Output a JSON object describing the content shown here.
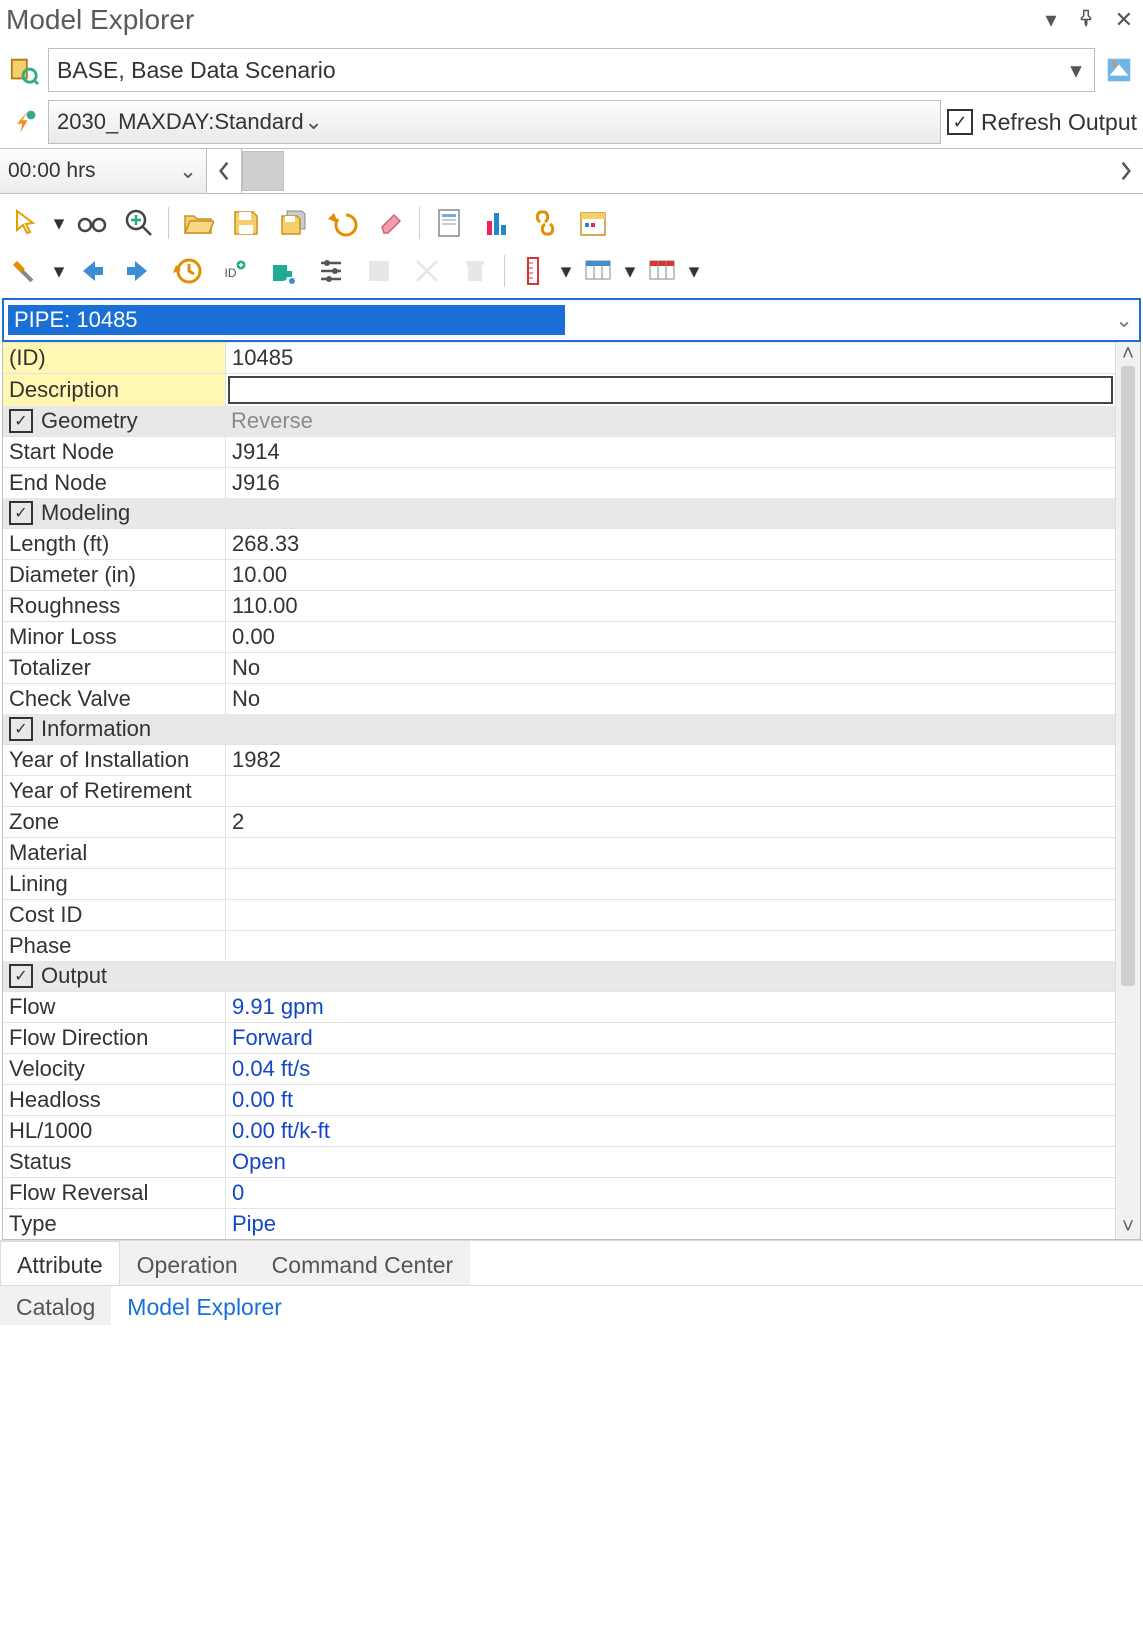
{
  "window": {
    "title": "Model Explorer"
  },
  "scenario": {
    "label": "BASE, Base Data Scenario"
  },
  "simulation": {
    "label": "2030_MAXDAY:Standard",
    "refresh_label": "Refresh Output"
  },
  "time": {
    "value": "00:00 hrs"
  },
  "element": {
    "selector": "PIPE: 10485"
  },
  "props": {
    "id_label": "(ID)",
    "id_value": "10485",
    "desc_label": "Description",
    "desc_value": "",
    "geometry_header": "Geometry",
    "reverse_label": "Reverse",
    "start_node_label": "Start Node",
    "start_node_value": "J914",
    "end_node_label": "End Node",
    "end_node_value": "J916",
    "modeling_header": "Modeling",
    "length_label": "Length (ft)",
    "length_value": "268.33",
    "diameter_label": "Diameter (in)",
    "diameter_value": "10.00",
    "roughness_label": "Roughness",
    "roughness_value": "110.00",
    "minor_loss_label": "Minor Loss",
    "minor_loss_value": "0.00",
    "totalizer_label": "Totalizer",
    "totalizer_value": "No",
    "check_valve_label": "Check Valve",
    "check_valve_value": "No",
    "information_header": "Information",
    "year_install_label": "Year of Installation",
    "year_install_value": "1982",
    "year_retire_label": "Year of Retirement",
    "year_retire_value": "",
    "zone_label": "Zone",
    "zone_value": "2",
    "material_label": "Material",
    "material_value": "",
    "lining_label": "Lining",
    "lining_value": "",
    "cost_id_label": "Cost ID",
    "cost_id_value": "",
    "phase_label": "Phase",
    "phase_value": "",
    "output_header": "Output",
    "flow_label": "Flow",
    "flow_value": "9.91 gpm",
    "flow_dir_label": "Flow Direction",
    "flow_dir_value": "Forward",
    "velocity_label": "Velocity",
    "velocity_value": "0.04 ft/s",
    "headloss_label": "Headloss",
    "headloss_value": "0.00 ft",
    "hl1000_label": "HL/1000",
    "hl1000_value": "0.00 ft/k-ft",
    "status_label": "Status",
    "status_value": "Open",
    "flow_reversal_label": "Flow Reversal",
    "flow_reversal_value": "0",
    "type_label": "Type",
    "type_value": "Pipe"
  },
  "tabs": {
    "attribute": "Attribute",
    "operation": "Operation",
    "command_center": "Command Center"
  },
  "tabs2": {
    "catalog": "Catalog",
    "model_explorer": "Model Explorer"
  }
}
